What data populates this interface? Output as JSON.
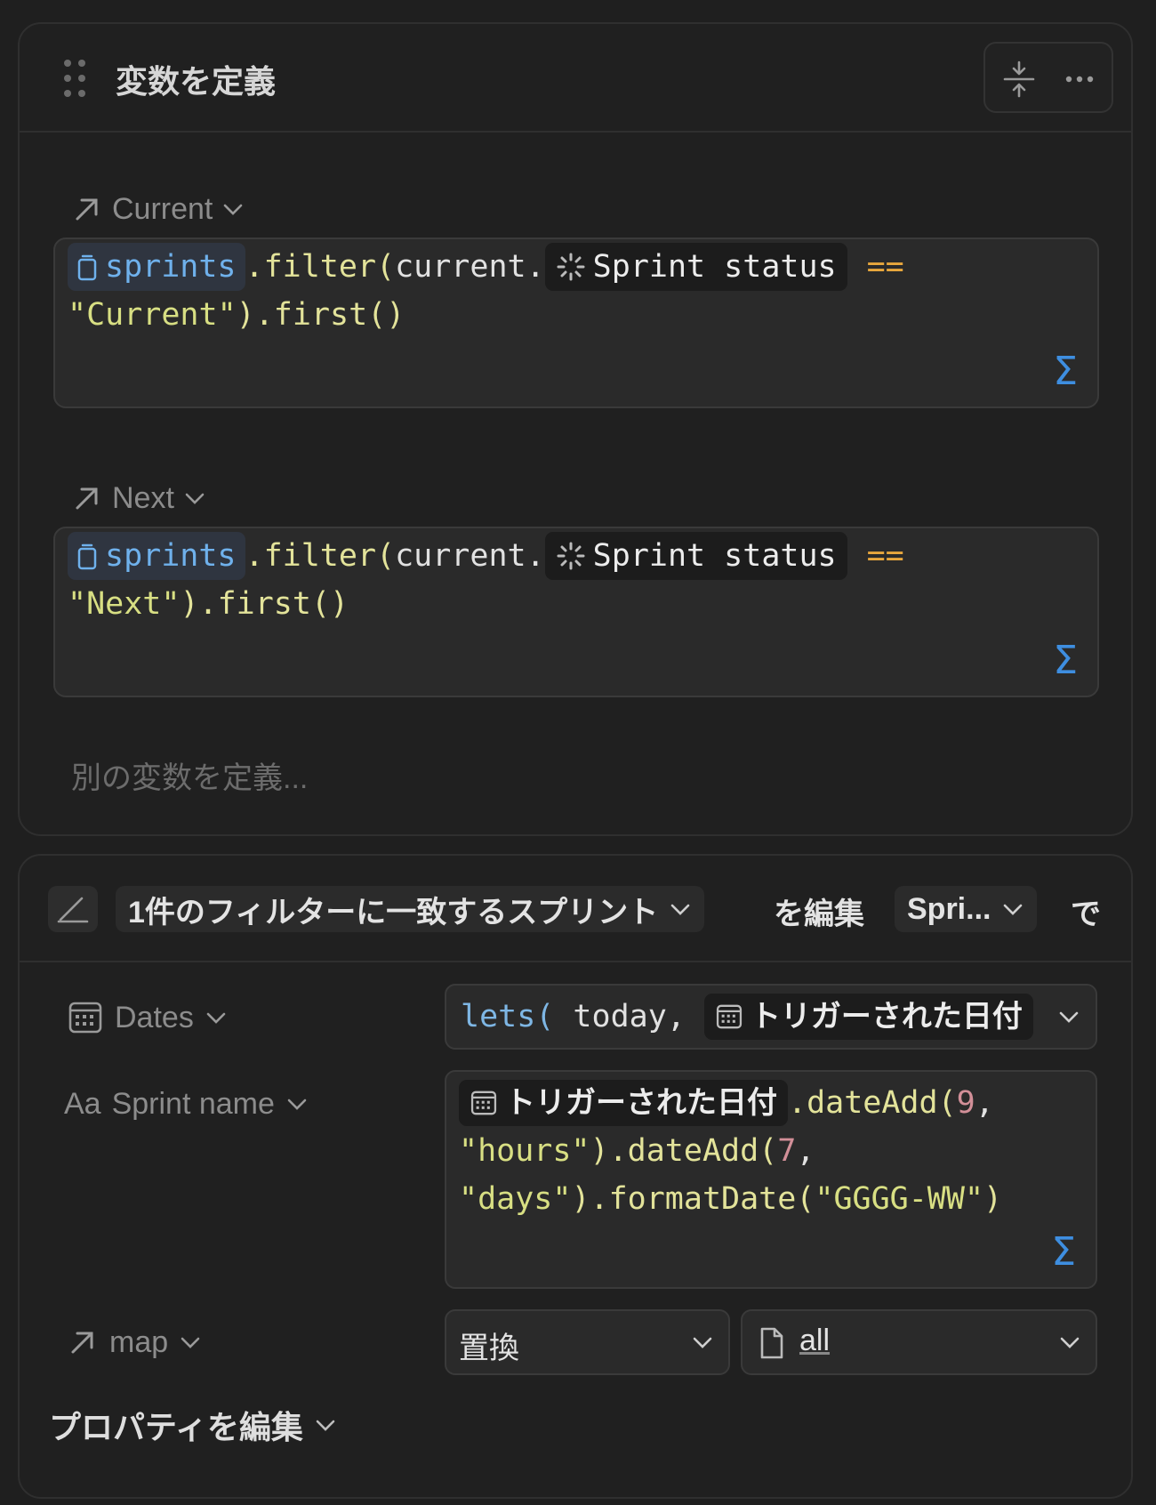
{
  "define_block": {
    "title": "変数を定義",
    "variables": [
      {
        "name": "Current",
        "formula": {
          "db_chip": "sprints",
          "method": ".filter(",
          "arg": "current.",
          "prop_chip": "Sprint status",
          "operator": "==",
          "string": "\"Current\"",
          "tail": ").first()"
        }
      },
      {
        "name": "Next",
        "formula": {
          "db_chip": "sprints",
          "method": ".filter(",
          "arg": "current.",
          "prop_chip": "Sprint status",
          "operator": "==",
          "string": "\"Next\"",
          "tail": ").first()"
        }
      }
    ],
    "add_variable_placeholder": "別の変数を定義..."
  },
  "edit_block": {
    "target_pill": "1件のフィルターに一致するスプリント",
    "verb": "を編集",
    "db_pill": "Spri...",
    "suffix": "で",
    "properties": [
      {
        "name": "Dates",
        "formula": {
          "kw": "lets(",
          "arg": " today, ",
          "chip": "トリガーされた日付"
        }
      },
      {
        "name": "Sprint name",
        "type_glyph": "Aa",
        "formula": {
          "chip": "トリガーされた日付",
          "fn1": ".dateAdd(",
          "num1": "9",
          "comma1": ",",
          "str1": "\"hours\"",
          "fn2": ").dateAdd(",
          "num2": "7",
          "comma2": ",",
          "str2": "\"days\"",
          "fn3": ").formatDate(",
          "str3": "\"GGGG-WW\"",
          "close": ")"
        }
      },
      {
        "name": "map",
        "mode_select": "置換",
        "value_select": "all"
      }
    ],
    "edit_properties_label": "プロパティを編集"
  },
  "icons": {
    "sigma_glyph": "Σ"
  },
  "colors": {
    "background": "#1f1f1f",
    "accent_blue": "#3e8ee0",
    "operator_orange": "#e8a73d",
    "string_yellow": "#d8df83",
    "number_pink": "#d28f98"
  }
}
